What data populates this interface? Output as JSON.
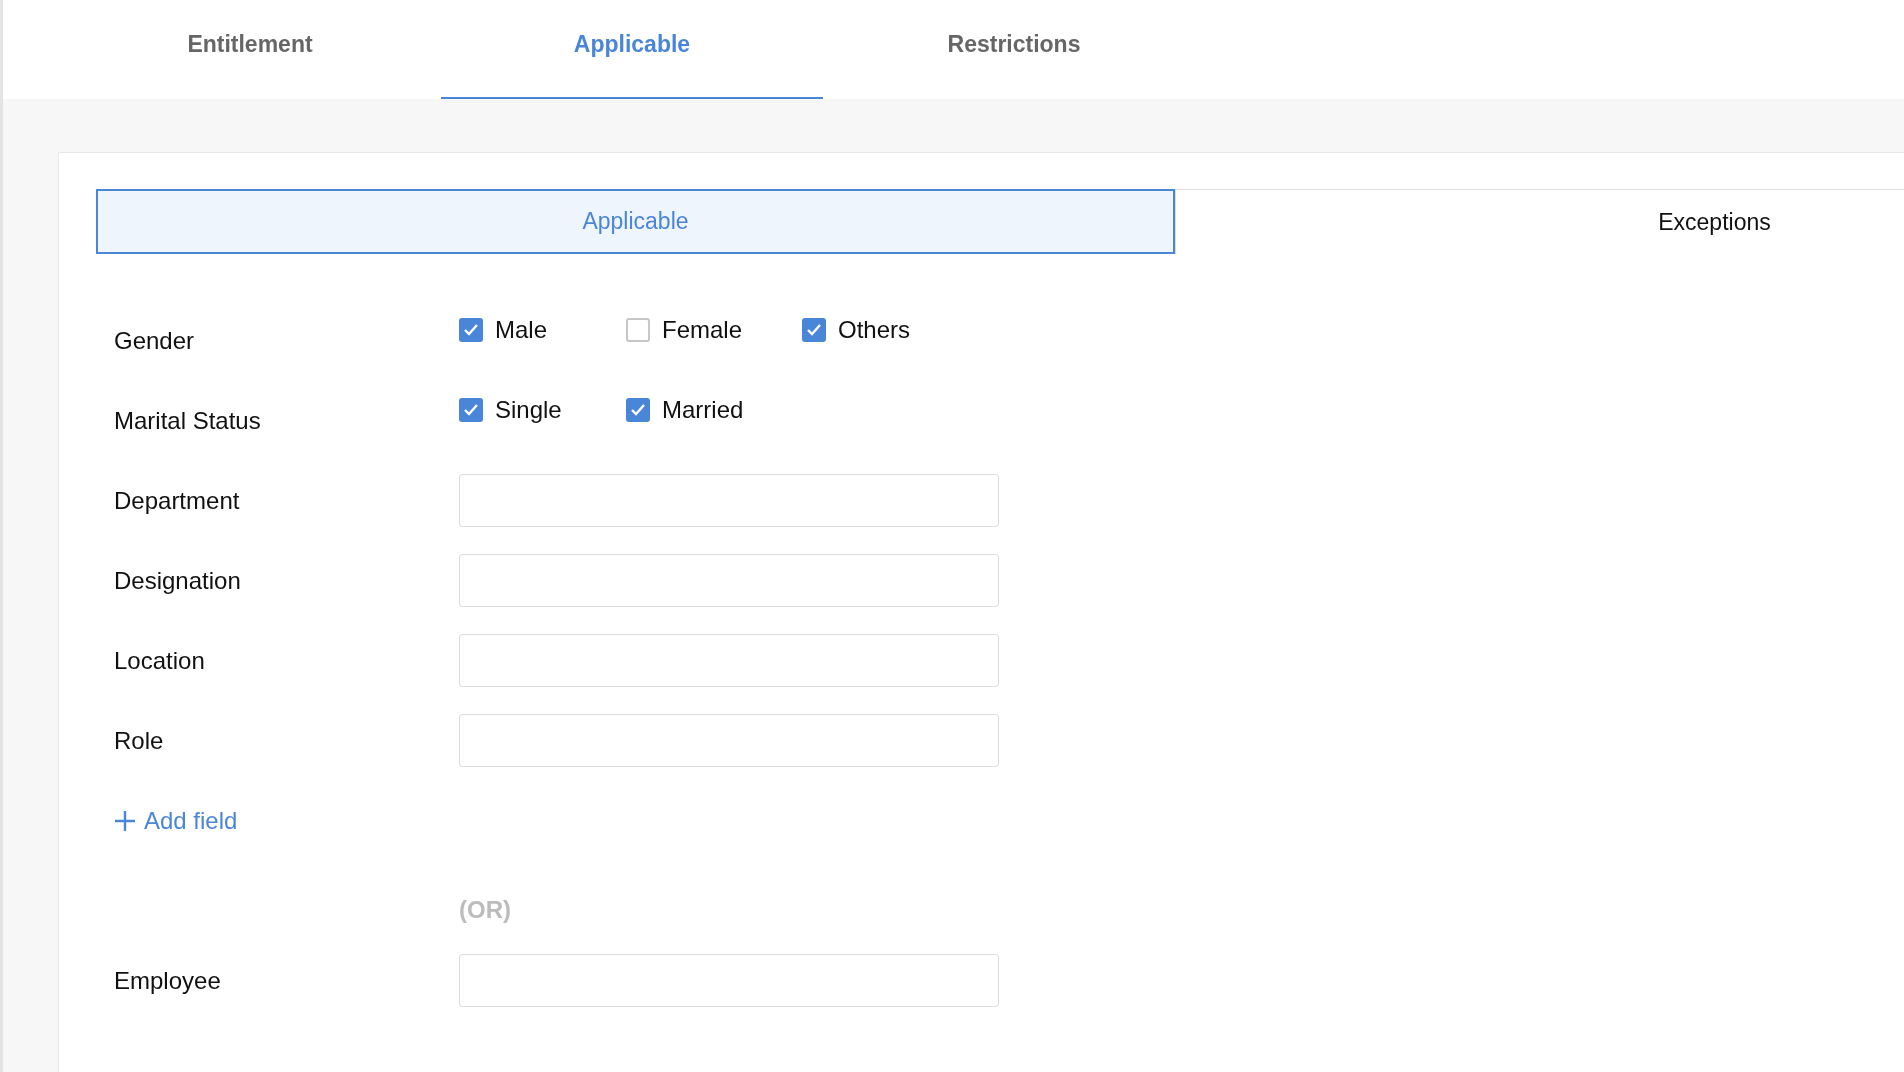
{
  "tabs": [
    {
      "label": "Entitlement",
      "selected": false
    },
    {
      "label": "Applicable",
      "selected": true
    },
    {
      "label": "Restrictions",
      "selected": false
    }
  ],
  "subtabs": [
    {
      "label": "Applicable",
      "selected": true
    },
    {
      "label": "Exceptions",
      "selected": false
    }
  ],
  "fields": [
    {
      "kind": "checks",
      "label": "Gender",
      "options": [
        {
          "label": "Male",
          "checked": true
        },
        {
          "label": "Female",
          "checked": false
        },
        {
          "label": "Others",
          "checked": true
        }
      ]
    },
    {
      "kind": "checks",
      "label": "Marital Status",
      "options": [
        {
          "label": "Single",
          "checked": true
        },
        {
          "label": "Married",
          "checked": true
        }
      ]
    },
    {
      "kind": "input",
      "label": "Department"
    },
    {
      "kind": "input",
      "label": "Designation"
    },
    {
      "kind": "input",
      "label": "Location"
    },
    {
      "kind": "input",
      "label": "Role"
    }
  ],
  "add_field": "Add field",
  "separator": "(OR)",
  "employee": {
    "label": "Employee"
  }
}
